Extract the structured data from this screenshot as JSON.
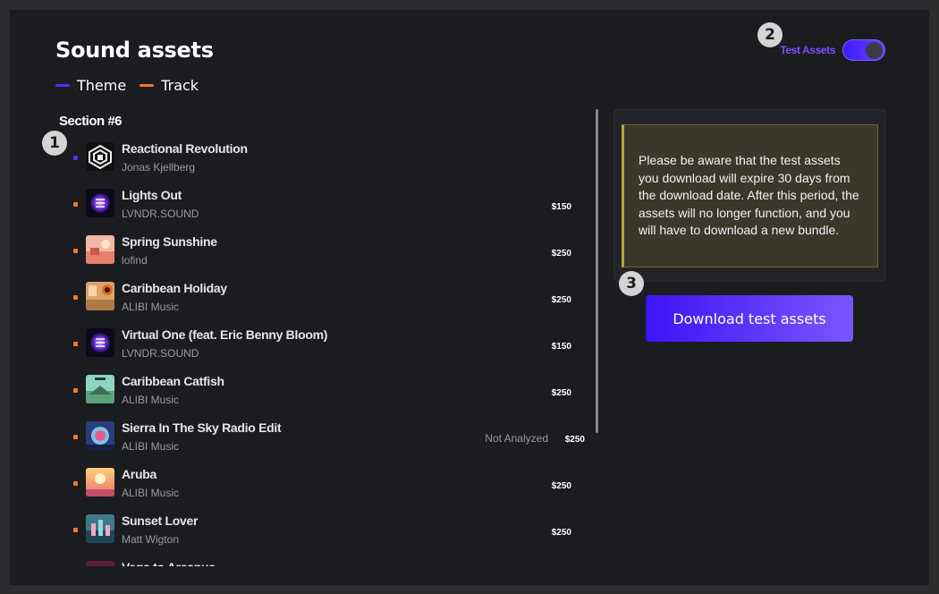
{
  "page": {
    "title": "Sound assets",
    "section_title": "Section #6"
  },
  "legend": [
    {
      "label": "Theme",
      "color": "#5b2bff"
    },
    {
      "label": "Track",
      "color": "#f07a2e"
    }
  ],
  "test_assets": {
    "label": "Test Assets",
    "enabled": true
  },
  "tracks": [
    {
      "name": "Reactional Revolution",
      "artist": "Jonas Kjellberg",
      "type": "theme",
      "price": "",
      "status": "",
      "art": "art-reactional"
    },
    {
      "name": "Lights Out",
      "artist": "LVNDR.SOUND",
      "type": "track",
      "price": "$150",
      "status": "",
      "art": "art-lvndr"
    },
    {
      "name": "Spring Sunshine",
      "artist": "lofind",
      "type": "track",
      "price": "$250",
      "status": "",
      "art": "art-spring"
    },
    {
      "name": "Caribbean Holiday",
      "artist": "ALIBI Music",
      "type": "track",
      "price": "$250",
      "status": "",
      "art": "art-caribbean"
    },
    {
      "name": "Virtual One (feat. Eric Benny Bloom)",
      "artist": "LVNDR.SOUND",
      "type": "track",
      "price": "$150",
      "status": "",
      "art": "art-lvndr"
    },
    {
      "name": "Caribbean Catfish",
      "artist": "ALIBI Music",
      "type": "track",
      "price": "$250",
      "status": "",
      "art": "art-catfish"
    },
    {
      "name": "Sierra In The Sky Radio Edit",
      "artist": "ALIBI Music",
      "type": "track",
      "price": "$250",
      "status": "Not Analyzed",
      "art": "art-sierra"
    },
    {
      "name": "Aruba",
      "artist": "ALIBI Music",
      "type": "track",
      "price": "$250",
      "status": "",
      "art": "art-aruba"
    },
    {
      "name": "Sunset Lover",
      "artist": "Matt Wigton",
      "type": "track",
      "price": "$250",
      "status": "",
      "art": "art-sunset"
    },
    {
      "name": "Vega to Arcanus",
      "artist": "",
      "type": "track",
      "price": "",
      "status": "",
      "art": "art-vega"
    }
  ],
  "notice": {
    "text": "Please be aware that the test assets you download will expire 30 days from the download date. After this period, the assets will no longer function, and you will have to download a new bundle."
  },
  "download_button": {
    "label": "Download test assets"
  },
  "markers": [
    "1",
    "2",
    "3"
  ],
  "colors": {
    "background": "#1b1c20",
    "accent": "#5b2bff",
    "track": "#f07a2e",
    "notice_bg": "#3a3829"
  }
}
